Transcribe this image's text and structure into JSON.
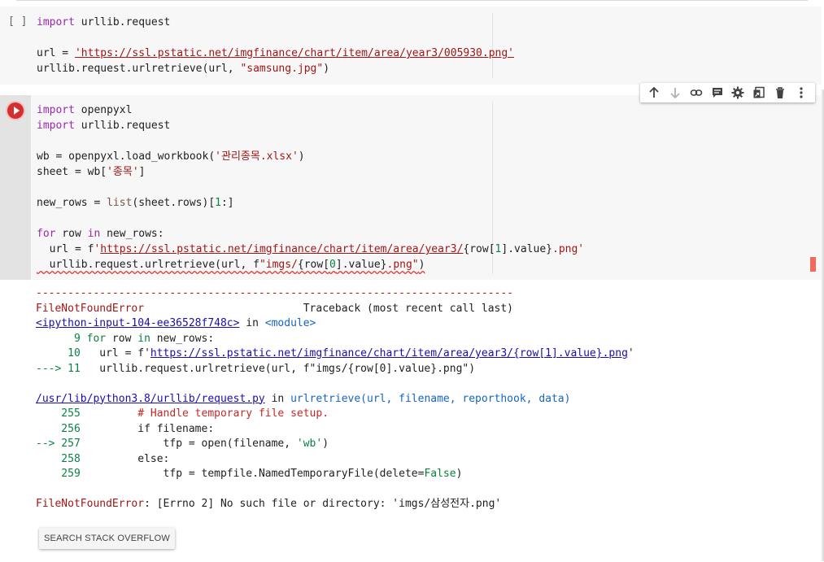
{
  "cell1": {
    "exec_label": "[ ]",
    "lines": {
      "l1_kw": "import",
      "l1_rest": " urllib.request",
      "l3_a": "url = ",
      "l3_str": "'https://ssl.pstatic.net/imgfinance/chart/item/area/year3/005930.png'",
      "l4_a": "urllib.request.urlretrieve(url, ",
      "l4_str": "\"samsung.jpg\"",
      "l4_b": ")"
    }
  },
  "cell2": {
    "lines": {
      "l1_kw": "import",
      "l1_rest": " openpyxl",
      "l2_kw": "import",
      "l2_rest": " urllib.request",
      "l4_a": "wb = openpyxl.load_workbook(",
      "l4_str": "'관리종목.xlsx'",
      "l4_b": ")",
      "l5_a": "sheet = wb[",
      "l5_str": "'종목'",
      "l5_b": "]",
      "l7_a": "new_rows = ",
      "l7_builtin": "list",
      "l7_b": "(sheet.rows)[",
      "l7_num": "1",
      "l7_c": ":]",
      "l9_kw1": "for",
      "l9_a": " row ",
      "l9_kw2": "in",
      "l9_b": " new_rows:",
      "l10_a": "  url = f",
      "l10_q1": "'",
      "l10_str": "https://ssl.pstatic.net/imgfinance/chart/item/area/year3/",
      "l10_b": "{row[",
      "l10_num": "1",
      "l10_c": "].value}",
      "l10_str2": ".png'",
      "l11_a": "  urllib.request.urlretrieve(url, f",
      "l11_str1": "\"imgs/",
      "l11_b": "{row[",
      "l11_num": "0",
      "l11_c": "].value}",
      "l11_str2": ".png\"",
      "l11_d": ")"
    }
  },
  "toolbar": {
    "items": [
      "move-up",
      "move-down",
      "link",
      "comment",
      "settings",
      "mirror-cell",
      "delete",
      "more"
    ]
  },
  "output": {
    "dashes": "---------------------------------------------------------------------------",
    "err_name": "FileNotFoundError",
    "tb_header": "                         Traceback (most recent call last)",
    "frame1_link": "<ipython-input-104-ee36528f748c>",
    "frame1_in": " in ",
    "frame1_mod": "<module>",
    "f1_l9_no": "      9",
    "f1_l9_kw1": " for",
    "f1_l9_a": " row ",
    "f1_l9_kw2": "in",
    "f1_l9_b": " new_rows:",
    "f1_l10_no": "     10",
    "f1_l10_a": "   url = f'",
    "f1_l10_link": "https://ssl.pstatic.net/imgfinance/chart/item/area/year3/{row[1].value}.png",
    "f1_l10_b": "'",
    "f1_l11_arrow": "---> 11",
    "f1_l11_a": "   urllib.request.urlretrieve(url, f\"imgs/{row[0].value}.png\")",
    "frame2_link": "/usr/lib/python3.8/urllib/request.py",
    "frame2_in": " in ",
    "frame2_func": "urlretrieve(url, filename, reporthook, data)",
    "f2_255_no": "    255",
    "f2_255_cmt": "         # Handle temporary file setup.",
    "f2_256_no": "    256",
    "f2_256_a": "         if filename:",
    "f2_257_arrow": "--> 257",
    "f2_257_a": "             tfp = open(filename, ",
    "f2_257_str": "'wb'",
    "f2_257_b": ")",
    "f2_258_no": "    258",
    "f2_258_a": "         else:",
    "f2_259_no": "    259",
    "f2_259_a": "             tfp = tempfile.NamedTemporaryFile(delete=",
    "f2_259_kw": "False",
    "f2_259_b": ")",
    "final_name": "FileNotFoundError",
    "final_msg": ": [Errno 2] No such file or directory: 'imgs/삼성전자.png'",
    "stack_button": "SEARCH STACK OVERFLOW"
  }
}
